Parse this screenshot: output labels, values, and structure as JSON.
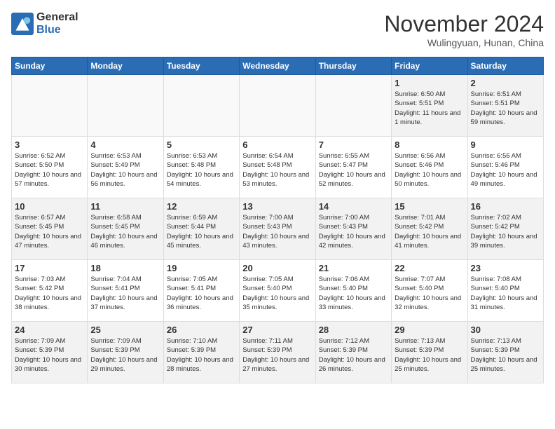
{
  "header": {
    "logo_general": "General",
    "logo_blue": "Blue",
    "month_title": "November 2024",
    "subtitle": "Wulingyuan, Hunan, China"
  },
  "days_of_week": [
    "Sunday",
    "Monday",
    "Tuesday",
    "Wednesday",
    "Thursday",
    "Friday",
    "Saturday"
  ],
  "weeks": [
    [
      {
        "day": "",
        "info": ""
      },
      {
        "day": "",
        "info": ""
      },
      {
        "day": "",
        "info": ""
      },
      {
        "day": "",
        "info": ""
      },
      {
        "day": "",
        "info": ""
      },
      {
        "day": "1",
        "info": "Sunrise: 6:50 AM\nSunset: 5:51 PM\nDaylight: 11 hours and 1 minute."
      },
      {
        "day": "2",
        "info": "Sunrise: 6:51 AM\nSunset: 5:51 PM\nDaylight: 10 hours and 59 minutes."
      }
    ],
    [
      {
        "day": "3",
        "info": "Sunrise: 6:52 AM\nSunset: 5:50 PM\nDaylight: 10 hours and 57 minutes."
      },
      {
        "day": "4",
        "info": "Sunrise: 6:53 AM\nSunset: 5:49 PM\nDaylight: 10 hours and 56 minutes."
      },
      {
        "day": "5",
        "info": "Sunrise: 6:53 AM\nSunset: 5:48 PM\nDaylight: 10 hours and 54 minutes."
      },
      {
        "day": "6",
        "info": "Sunrise: 6:54 AM\nSunset: 5:48 PM\nDaylight: 10 hours and 53 minutes."
      },
      {
        "day": "7",
        "info": "Sunrise: 6:55 AM\nSunset: 5:47 PM\nDaylight: 10 hours and 52 minutes."
      },
      {
        "day": "8",
        "info": "Sunrise: 6:56 AM\nSunset: 5:46 PM\nDaylight: 10 hours and 50 minutes."
      },
      {
        "day": "9",
        "info": "Sunrise: 6:56 AM\nSunset: 5:46 PM\nDaylight: 10 hours and 49 minutes."
      }
    ],
    [
      {
        "day": "10",
        "info": "Sunrise: 6:57 AM\nSunset: 5:45 PM\nDaylight: 10 hours and 47 minutes."
      },
      {
        "day": "11",
        "info": "Sunrise: 6:58 AM\nSunset: 5:45 PM\nDaylight: 10 hours and 46 minutes."
      },
      {
        "day": "12",
        "info": "Sunrise: 6:59 AM\nSunset: 5:44 PM\nDaylight: 10 hours and 45 minutes."
      },
      {
        "day": "13",
        "info": "Sunrise: 7:00 AM\nSunset: 5:43 PM\nDaylight: 10 hours and 43 minutes."
      },
      {
        "day": "14",
        "info": "Sunrise: 7:00 AM\nSunset: 5:43 PM\nDaylight: 10 hours and 42 minutes."
      },
      {
        "day": "15",
        "info": "Sunrise: 7:01 AM\nSunset: 5:42 PM\nDaylight: 10 hours and 41 minutes."
      },
      {
        "day": "16",
        "info": "Sunrise: 7:02 AM\nSunset: 5:42 PM\nDaylight: 10 hours and 39 minutes."
      }
    ],
    [
      {
        "day": "17",
        "info": "Sunrise: 7:03 AM\nSunset: 5:42 PM\nDaylight: 10 hours and 38 minutes."
      },
      {
        "day": "18",
        "info": "Sunrise: 7:04 AM\nSunset: 5:41 PM\nDaylight: 10 hours and 37 minutes."
      },
      {
        "day": "19",
        "info": "Sunrise: 7:05 AM\nSunset: 5:41 PM\nDaylight: 10 hours and 36 minutes."
      },
      {
        "day": "20",
        "info": "Sunrise: 7:05 AM\nSunset: 5:40 PM\nDaylight: 10 hours and 35 minutes."
      },
      {
        "day": "21",
        "info": "Sunrise: 7:06 AM\nSunset: 5:40 PM\nDaylight: 10 hours and 33 minutes."
      },
      {
        "day": "22",
        "info": "Sunrise: 7:07 AM\nSunset: 5:40 PM\nDaylight: 10 hours and 32 minutes."
      },
      {
        "day": "23",
        "info": "Sunrise: 7:08 AM\nSunset: 5:40 PM\nDaylight: 10 hours and 31 minutes."
      }
    ],
    [
      {
        "day": "24",
        "info": "Sunrise: 7:09 AM\nSunset: 5:39 PM\nDaylight: 10 hours and 30 minutes."
      },
      {
        "day": "25",
        "info": "Sunrise: 7:09 AM\nSunset: 5:39 PM\nDaylight: 10 hours and 29 minutes."
      },
      {
        "day": "26",
        "info": "Sunrise: 7:10 AM\nSunset: 5:39 PM\nDaylight: 10 hours and 28 minutes."
      },
      {
        "day": "27",
        "info": "Sunrise: 7:11 AM\nSunset: 5:39 PM\nDaylight: 10 hours and 27 minutes."
      },
      {
        "day": "28",
        "info": "Sunrise: 7:12 AM\nSunset: 5:39 PM\nDaylight: 10 hours and 26 minutes."
      },
      {
        "day": "29",
        "info": "Sunrise: 7:13 AM\nSunset: 5:39 PM\nDaylight: 10 hours and 25 minutes."
      },
      {
        "day": "30",
        "info": "Sunrise: 7:13 AM\nSunset: 5:39 PM\nDaylight: 10 hours and 25 minutes."
      }
    ]
  ]
}
